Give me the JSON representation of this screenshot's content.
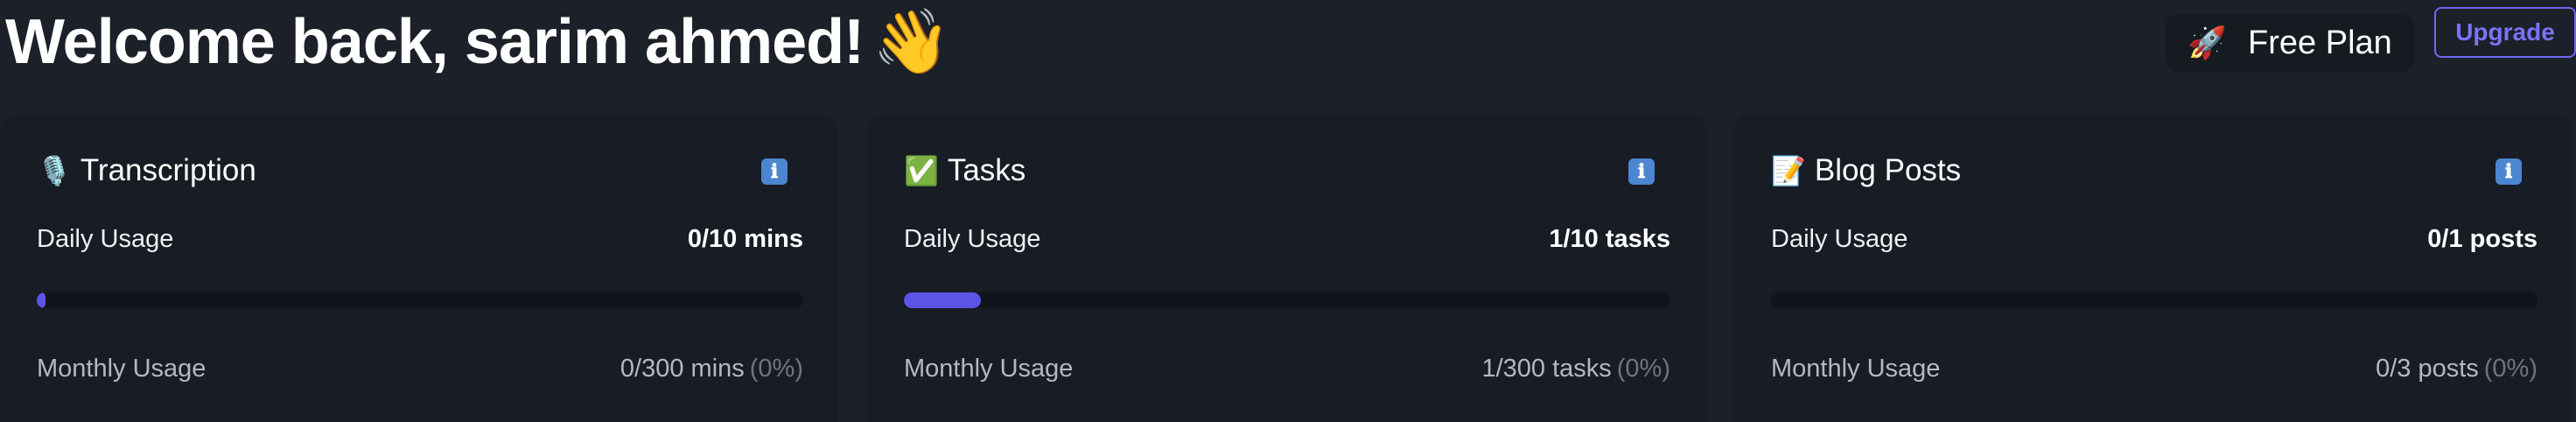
{
  "header": {
    "welcome": "Welcome back, sarim ahmed!",
    "wave_emoji": "👋",
    "plan_icon": "🚀",
    "plan_label": "Free Plan",
    "upgrade_label": "Upgrade"
  },
  "theme": {
    "background": "#1c2029",
    "card_background": "#181c24",
    "accent": "#5b55e8",
    "upgrade_border": "#6d66f3",
    "info_icon_bg": "#4c86d0"
  },
  "cards": [
    {
      "icon": "🎙️",
      "icon_name": "microphone-icon",
      "title": "Transcription",
      "info_icon": "ℹ",
      "daily_label": "Daily Usage",
      "daily_value": "0/10 mins",
      "daily_progress_fraction": 0.0,
      "monthly_label": "Monthly Usage",
      "monthly_value": "0/300 mins",
      "monthly_percent": "(0%)"
    },
    {
      "icon": "✅",
      "icon_name": "check-mark-icon",
      "title": "Tasks",
      "info_icon": "ℹ",
      "daily_label": "Daily Usage",
      "daily_value": "1/10 tasks",
      "daily_progress_fraction": 0.1,
      "monthly_label": "Monthly Usage",
      "monthly_value": "1/300 tasks",
      "monthly_percent": "(0%)"
    },
    {
      "icon": "📝",
      "icon_name": "memo-icon",
      "title": "Blog Posts",
      "info_icon": "ℹ",
      "daily_label": "Daily Usage",
      "daily_value": "0/1 posts",
      "daily_progress_fraction": 0.0,
      "monthly_label": "Monthly Usage",
      "monthly_value": "0/3 posts",
      "monthly_percent": "(0%)"
    }
  ]
}
